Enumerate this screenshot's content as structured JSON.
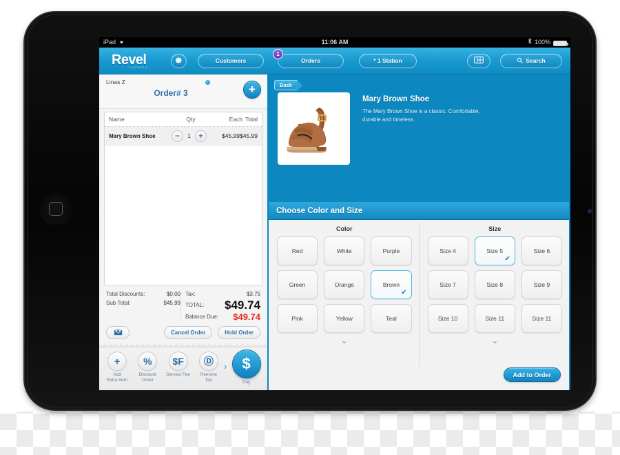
{
  "status_bar": {
    "device": "iPad",
    "wifi_icon": "wifi-icon",
    "time": "11:06 AM",
    "bluetooth_icon": "bluetooth-icon",
    "battery": "100%"
  },
  "navbar": {
    "logo": "Revel",
    "logo_sub": "systems",
    "gear_icon": "gear-icon",
    "customers_label": "Customers",
    "orders_label": "Orders",
    "orders_badge": "1",
    "station_label": "* 1 Station",
    "grid_icon": "grid-icon",
    "search_label": "Search",
    "search_icon": "search-icon",
    "accent": "#0d87bf"
  },
  "order_panel": {
    "customer_name": "Linas Z",
    "order_number": "Order# 3",
    "add_button": "+",
    "columns": [
      "Name",
      "Qty",
      "Each",
      "Total"
    ],
    "items": [
      {
        "name": "Mary Brown Shoe",
        "decrement": "−",
        "qty": "1",
        "increment": "+",
        "each": "$45.99",
        "total": "$45.99"
      }
    ],
    "totals_left": [
      {
        "label": "Total Discounts:",
        "value": "$0.00"
      },
      {
        "label": "Sub Total:",
        "value": "$45.99"
      }
    ],
    "tax_label": "Tax:",
    "tax_value": "$3.75",
    "total_label": "TOTAL:",
    "total_value": "$49.74",
    "balance_label": "Balance Due:",
    "balance_value": "$49.74",
    "balance_color": "#e02b20",
    "mail_icon": "mail-icon",
    "cancel_order_label": "Cancel Order",
    "hold_order_label": "Hold Order",
    "toolbar": [
      {
        "glyph": "+",
        "icon": "plus-icon",
        "line1": "Add",
        "line2": "Extra Item"
      },
      {
        "glyph": "%",
        "icon": "percent-icon",
        "line1": "Discount",
        "line2": "Order"
      },
      {
        "glyph": "$F",
        "icon": "service-fee-icon",
        "line1": "Service Fee",
        "line2": ""
      },
      {
        "glyph": "Ⓓ",
        "icon": "remove-tax-icon",
        "line1": "Remove",
        "line2": "Tax"
      }
    ],
    "chevron": "›",
    "pay_glyph": "$",
    "pay_label": "Pay"
  },
  "product": {
    "back_label": "Back",
    "title": "Mary Brown Shoe",
    "description": "The Mary Brown Shoe is a classic. Comfortable, durable and timeless.",
    "image_alt": "brown-sandal-photo"
  },
  "options": {
    "header": "Choose Color and Size",
    "color_title": "Color",
    "size_title": "Size",
    "colors": [
      {
        "label": "Red",
        "selected": false
      },
      {
        "label": "White",
        "selected": false
      },
      {
        "label": "Purple",
        "selected": false
      },
      {
        "label": "Green",
        "selected": false
      },
      {
        "label": "Orange",
        "selected": false
      },
      {
        "label": "Brown",
        "selected": true
      },
      {
        "label": "Pink",
        "selected": false
      },
      {
        "label": "Yellow",
        "selected": false
      },
      {
        "label": "Teal",
        "selected": false
      }
    ],
    "sizes": [
      {
        "label": "Size 4",
        "selected": false
      },
      {
        "label": "Size 5",
        "selected": true
      },
      {
        "label": "Size 6",
        "selected": false
      },
      {
        "label": "Size 7",
        "selected": false
      },
      {
        "label": "Size 8",
        "selected": false
      },
      {
        "label": "Size 9",
        "selected": false
      },
      {
        "label": "Size 10",
        "selected": false
      },
      {
        "label": "Size 11",
        "selected": false
      },
      {
        "label": "Size 11",
        "selected": false
      }
    ],
    "more_chevron": "⌄",
    "check_glyph": "✔",
    "add_to_order_label": "Add to Order"
  }
}
